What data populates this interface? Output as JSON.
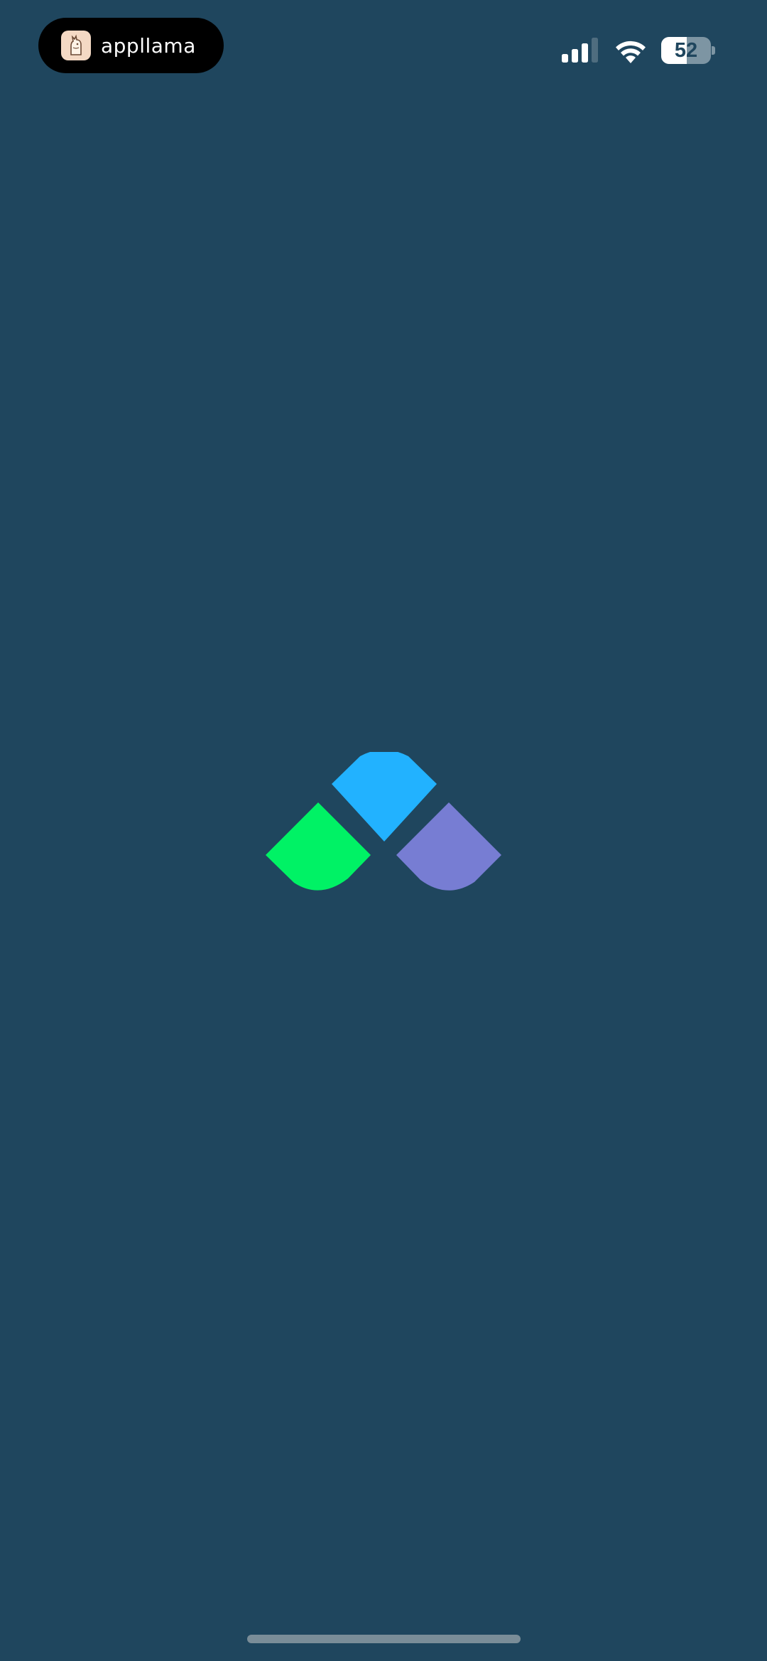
{
  "status_bar": {
    "app_name": "appllama",
    "app_icon": "llama-icon",
    "battery_level": "52",
    "battery_fraction": 0.52,
    "signal_bars_active": 3,
    "signal_bars_total": 4
  },
  "splash": {
    "logo": "app-logo",
    "colors": {
      "top": "#22b2ff",
      "left": "#00f265",
      "right": "#777dd3"
    }
  },
  "colors": {
    "background": "#1f465e"
  }
}
